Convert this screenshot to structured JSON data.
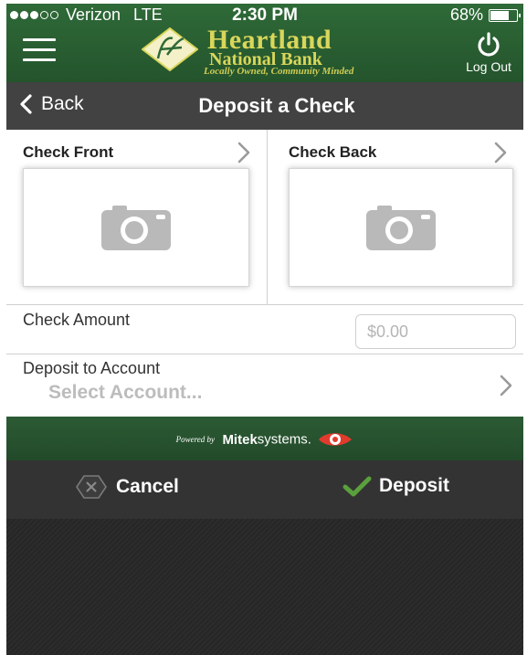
{
  "status_bar": {
    "carrier": "Verizon",
    "network": "LTE",
    "time": "2:30 PM",
    "battery": "68%",
    "battery_level": 0.68,
    "signal_bars": 3,
    "signal_total": 5
  },
  "header": {
    "menu_icon": "hamburger-menu-icon",
    "logo_name": "Heartland",
    "logo_sub": "National Bank",
    "logo_tagline": "Locally Owned, Community Minded",
    "logout_label": "Log Out",
    "logout_icon": "power-icon",
    "brand_color": "#2f6a38",
    "logo_color": "#d9d65a"
  },
  "nav": {
    "back_label": "Back",
    "title": "Deposit a Check"
  },
  "checks": {
    "front_label": "Check Front",
    "back_label": "Check Back",
    "camera_icon": "camera-icon"
  },
  "amount": {
    "label": "Check Amount",
    "placeholder": "$0.00"
  },
  "account": {
    "label": "Deposit to Account",
    "value": "Select Account..."
  },
  "powered_by": {
    "prefix": "Powered by",
    "brand_bold": "Mitek",
    "brand_rest": "systems."
  },
  "actions": {
    "cancel_label": "Cancel",
    "deposit_label": "Deposit",
    "accent_color": "#5aa03c"
  }
}
